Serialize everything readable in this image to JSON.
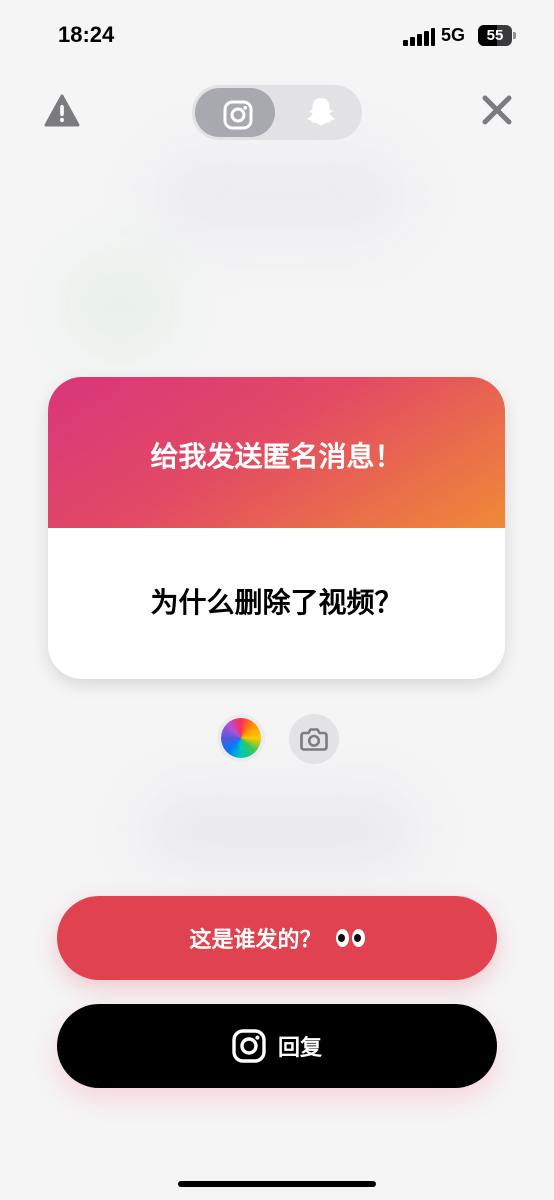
{
  "status_bar": {
    "time": "18:24",
    "network": "5G",
    "battery_percent": "55"
  },
  "tabs": {
    "instagram_icon": "instagram-icon",
    "snapchat_icon": "snapchat-ghost-icon",
    "active": "instagram"
  },
  "card": {
    "title": "给我发送匿名消息！",
    "message": "为什么删除了视频？"
  },
  "buttons": {
    "who_sent": "这是谁发的？",
    "who_sent_emoji": "eyes-emoji",
    "reply": "回复"
  },
  "colors": {
    "gradient_start": "#d9357b",
    "gradient_end": "#ef8a36",
    "who_button": "#e0434f",
    "reply_button": "#000000"
  }
}
